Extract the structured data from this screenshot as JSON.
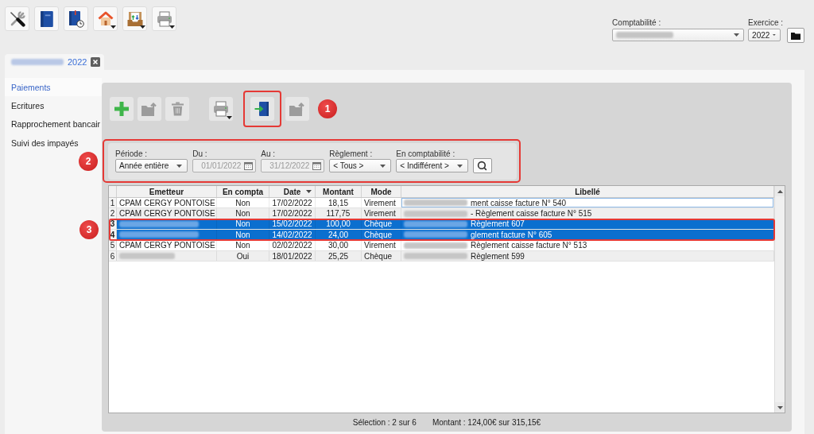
{
  "toolbar": [
    {
      "kind": "tools",
      "menu": false
    },
    {
      "kind": "book",
      "menu": false
    },
    {
      "kind": "journal",
      "menu": false
    },
    {
      "kind": "home",
      "menu": true
    },
    {
      "kind": "inbox",
      "menu": true
    },
    {
      "kind": "print",
      "menu": true
    }
  ],
  "company": {
    "label": "Comptabilité :"
  },
  "fiscal_year": {
    "label": "Exercice :",
    "value": "2022"
  },
  "tabs": [
    {
      "label": "2022",
      "selected": true
    }
  ],
  "sidebar": {
    "items": [
      {
        "label": "Paiements",
        "selected": true
      },
      {
        "label": "Ecritures",
        "selected": false
      },
      {
        "label": "Rapprochement bancair",
        "selected": false
      },
      {
        "label": "Suivi des impayés",
        "selected": false
      }
    ]
  },
  "actions": [
    {
      "kind": "add",
      "disabled": false,
      "menu": false,
      "highlighted": false
    },
    {
      "kind": "export",
      "disabled": true,
      "menu": false,
      "highlighted": false
    },
    {
      "kind": "delete",
      "disabled": true,
      "menu": false,
      "highlighted": false
    },
    {
      "kind": "print",
      "disabled": false,
      "menu": true,
      "highlighted": false
    },
    {
      "kind": "post",
      "disabled": false,
      "menu": false,
      "highlighted": true
    },
    {
      "kind": "export",
      "disabled": true,
      "menu": false,
      "highlighted": false
    }
  ],
  "filters": {
    "highlighted": true,
    "fields": [
      {
        "kind": "select",
        "label": "Période :",
        "value": "Année entière"
      },
      {
        "kind": "date",
        "label": "Du :",
        "value": "01/01/2022",
        "disabled": true
      },
      {
        "kind": "date",
        "label": "Au :",
        "value": "31/12/2022",
        "disabled": true
      },
      {
        "kind": "select",
        "label": "Règlement :",
        "value": "< Tous >"
      },
      {
        "kind": "select",
        "label": "En comptabilité :",
        "value": "< Indifférent >"
      },
      {
        "kind": "search"
      }
    ]
  },
  "table": {
    "columns": [
      {
        "label": "Emetteur",
        "sorted": false
      },
      {
        "label": "En compta",
        "sorted": false
      },
      {
        "label": "Date",
        "sorted": true
      },
      {
        "label": "Montant",
        "sorted": false
      },
      {
        "label": "Mode",
        "sorted": false
      },
      {
        "label": "Libellé",
        "sorted": false
      }
    ],
    "rows": [
      {
        "number": "1",
        "emetteur": "CPAM CERGY PONTOISE",
        "en_compta": "Non",
        "date": "17/02/2022",
        "montant": "18,15",
        "mode": "Virement",
        "libelle": "ment caisse facture N° 540",
        "selected": false,
        "focused": true,
        "highlighted": false
      },
      {
        "number": "2",
        "emetteur": "CPAM CERGY PONTOISE",
        "en_compta": "Non",
        "date": "17/02/2022",
        "montant": "117,75",
        "mode": "Virement",
        "libelle": "- Règlement caisse facture N° 515",
        "selected": false,
        "focused": false,
        "highlighted": false
      },
      {
        "number": "3",
        "en_compta": "Non",
        "date": "15/02/2022",
        "montant": "100,00",
        "mode": "Chèque",
        "libelle": "Règlement 607",
        "selected": true,
        "focused": false,
        "highlighted": true
      },
      {
        "number": "4",
        "en_compta": "Non",
        "date": "14/02/2022",
        "montant": "24,00",
        "mode": "Chèque",
        "libelle": "glement facture N° 605",
        "selected": true,
        "focused": false,
        "highlighted": true
      },
      {
        "number": "5",
        "emetteur": "CPAM CERGY PONTOISE",
        "en_compta": "Non",
        "date": "02/02/2022",
        "montant": "30,00",
        "mode": "Virement",
        "libelle": "Règlement caisse facture N° 513",
        "selected": false,
        "focused": false,
        "highlighted": false
      },
      {
        "number": "6",
        "en_compta": "Oui",
        "date": "18/01/2022",
        "montant": "25,25",
        "mode": "Chèque",
        "libelle": "Règlement 599",
        "selected": false,
        "focused": false,
        "highlighted": false
      }
    ]
  },
  "status_bar": {
    "selection": "Sélection : 2 sur 6",
    "amount": "Montant : 124,00€ sur 315,15€"
  },
  "annotations": [
    {
      "label": "1"
    },
    {
      "label": "2"
    },
    {
      "label": "3"
    }
  ]
}
